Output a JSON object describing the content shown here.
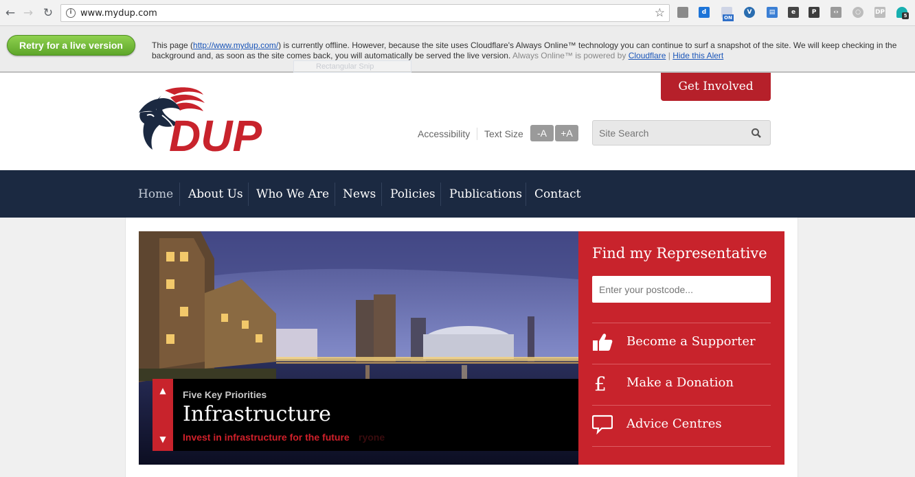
{
  "browser": {
    "url": "www.mydup.com",
    "extensions": [
      "doc-icon",
      "d-icon",
      "on-badge-icon",
      "v-icon",
      "reader-icon",
      "evernote-icon",
      "p-icon",
      "code-icon",
      "circle-icon",
      "dp-icon",
      "ghost-icon"
    ],
    "badge_on": "ON",
    "badge_count": "5"
  },
  "cloudflare": {
    "retry_label": "Retry for a live version",
    "msg_prefix": "This page (",
    "msg_link": "http://www.mydup.com/",
    "msg_body": ") is currently offline. However, because the site uses Cloudflare's Always Online™ technology you can continue to surf a snapshot of the site. We will keep checking in the background and, as soon as the site comes back, you will automatically be served the live version.",
    "powered": "Always Online™ is powered by",
    "powered_link": "Cloudflare",
    "divider": "|",
    "hide_link": "Hide this Alert",
    "ghost_tooltip": "Rectangular Snip"
  },
  "header": {
    "logo_text": "DUP",
    "get_involved": "Get Involved",
    "accessibility": "Accessibility",
    "text_size": "Text Size",
    "decrease": "-A",
    "increase": "+A",
    "search_placeholder": "Site Search"
  },
  "nav": {
    "items": [
      "Home",
      "About Us",
      "Who We Are",
      "News",
      "Policies",
      "Publications",
      "Contact"
    ],
    "active": "Home"
  },
  "slider": {
    "kicker": "Five Key Priorities",
    "title": "Infrastructure",
    "subtitle": "Invest in infrastructure for the future",
    "ghost_text": "ryone"
  },
  "representative": {
    "title": "Find my Representative",
    "postcode_placeholder": "Enter your postcode...",
    "links": [
      {
        "label": "Become a Supporter",
        "icon": "thumbs-up-icon"
      },
      {
        "label": "Make a Donation",
        "icon": "pound-icon"
      },
      {
        "label": "Advice Centres",
        "icon": "speech-bubble-icon"
      }
    ]
  },
  "colors": {
    "brand_red": "#c8232c",
    "nav_navy": "#1b2941",
    "cloudflare_green": "#5ea62a"
  }
}
